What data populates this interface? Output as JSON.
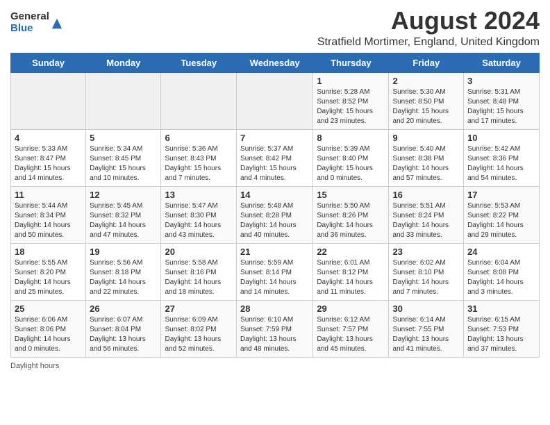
{
  "header": {
    "logo_general": "General",
    "logo_blue": "Blue",
    "month_year": "August 2024",
    "location": "Stratfield Mortimer, England, United Kingdom"
  },
  "weekdays": [
    "Sunday",
    "Monday",
    "Tuesday",
    "Wednesday",
    "Thursday",
    "Friday",
    "Saturday"
  ],
  "footer": {
    "note": "Daylight hours"
  },
  "weeks": [
    [
      {
        "day": "",
        "info": ""
      },
      {
        "day": "",
        "info": ""
      },
      {
        "day": "",
        "info": ""
      },
      {
        "day": "",
        "info": ""
      },
      {
        "day": "1",
        "info": "Sunrise: 5:28 AM\nSunset: 8:52 PM\nDaylight: 15 hours\nand 23 minutes."
      },
      {
        "day": "2",
        "info": "Sunrise: 5:30 AM\nSunset: 8:50 PM\nDaylight: 15 hours\nand 20 minutes."
      },
      {
        "day": "3",
        "info": "Sunrise: 5:31 AM\nSunset: 8:48 PM\nDaylight: 15 hours\nand 17 minutes."
      }
    ],
    [
      {
        "day": "4",
        "info": "Sunrise: 5:33 AM\nSunset: 8:47 PM\nDaylight: 15 hours\nand 14 minutes."
      },
      {
        "day": "5",
        "info": "Sunrise: 5:34 AM\nSunset: 8:45 PM\nDaylight: 15 hours\nand 10 minutes."
      },
      {
        "day": "6",
        "info": "Sunrise: 5:36 AM\nSunset: 8:43 PM\nDaylight: 15 hours\nand 7 minutes."
      },
      {
        "day": "7",
        "info": "Sunrise: 5:37 AM\nSunset: 8:42 PM\nDaylight: 15 hours\nand 4 minutes."
      },
      {
        "day": "8",
        "info": "Sunrise: 5:39 AM\nSunset: 8:40 PM\nDaylight: 15 hours\nand 0 minutes."
      },
      {
        "day": "9",
        "info": "Sunrise: 5:40 AM\nSunset: 8:38 PM\nDaylight: 14 hours\nand 57 minutes."
      },
      {
        "day": "10",
        "info": "Sunrise: 5:42 AM\nSunset: 8:36 PM\nDaylight: 14 hours\nand 54 minutes."
      }
    ],
    [
      {
        "day": "11",
        "info": "Sunrise: 5:44 AM\nSunset: 8:34 PM\nDaylight: 14 hours\nand 50 minutes."
      },
      {
        "day": "12",
        "info": "Sunrise: 5:45 AM\nSunset: 8:32 PM\nDaylight: 14 hours\nand 47 minutes."
      },
      {
        "day": "13",
        "info": "Sunrise: 5:47 AM\nSunset: 8:30 PM\nDaylight: 14 hours\nand 43 minutes."
      },
      {
        "day": "14",
        "info": "Sunrise: 5:48 AM\nSunset: 8:28 PM\nDaylight: 14 hours\nand 40 minutes."
      },
      {
        "day": "15",
        "info": "Sunrise: 5:50 AM\nSunset: 8:26 PM\nDaylight: 14 hours\nand 36 minutes."
      },
      {
        "day": "16",
        "info": "Sunrise: 5:51 AM\nSunset: 8:24 PM\nDaylight: 14 hours\nand 33 minutes."
      },
      {
        "day": "17",
        "info": "Sunrise: 5:53 AM\nSunset: 8:22 PM\nDaylight: 14 hours\nand 29 minutes."
      }
    ],
    [
      {
        "day": "18",
        "info": "Sunrise: 5:55 AM\nSunset: 8:20 PM\nDaylight: 14 hours\nand 25 minutes."
      },
      {
        "day": "19",
        "info": "Sunrise: 5:56 AM\nSunset: 8:18 PM\nDaylight: 14 hours\nand 22 minutes."
      },
      {
        "day": "20",
        "info": "Sunrise: 5:58 AM\nSunset: 8:16 PM\nDaylight: 14 hours\nand 18 minutes."
      },
      {
        "day": "21",
        "info": "Sunrise: 5:59 AM\nSunset: 8:14 PM\nDaylight: 14 hours\nand 14 minutes."
      },
      {
        "day": "22",
        "info": "Sunrise: 6:01 AM\nSunset: 8:12 PM\nDaylight: 14 hours\nand 11 minutes."
      },
      {
        "day": "23",
        "info": "Sunrise: 6:02 AM\nSunset: 8:10 PM\nDaylight: 14 hours\nand 7 minutes."
      },
      {
        "day": "24",
        "info": "Sunrise: 6:04 AM\nSunset: 8:08 PM\nDaylight: 14 hours\nand 3 minutes."
      }
    ],
    [
      {
        "day": "25",
        "info": "Sunrise: 6:06 AM\nSunset: 8:06 PM\nDaylight: 14 hours\nand 0 minutes."
      },
      {
        "day": "26",
        "info": "Sunrise: 6:07 AM\nSunset: 8:04 PM\nDaylight: 13 hours\nand 56 minutes."
      },
      {
        "day": "27",
        "info": "Sunrise: 6:09 AM\nSunset: 8:02 PM\nDaylight: 13 hours\nand 52 minutes."
      },
      {
        "day": "28",
        "info": "Sunrise: 6:10 AM\nSunset: 7:59 PM\nDaylight: 13 hours\nand 48 minutes."
      },
      {
        "day": "29",
        "info": "Sunrise: 6:12 AM\nSunset: 7:57 PM\nDaylight: 13 hours\nand 45 minutes."
      },
      {
        "day": "30",
        "info": "Sunrise: 6:14 AM\nSunset: 7:55 PM\nDaylight: 13 hours\nand 41 minutes."
      },
      {
        "day": "31",
        "info": "Sunrise: 6:15 AM\nSunset: 7:53 PM\nDaylight: 13 hours\nand 37 minutes."
      }
    ]
  ]
}
